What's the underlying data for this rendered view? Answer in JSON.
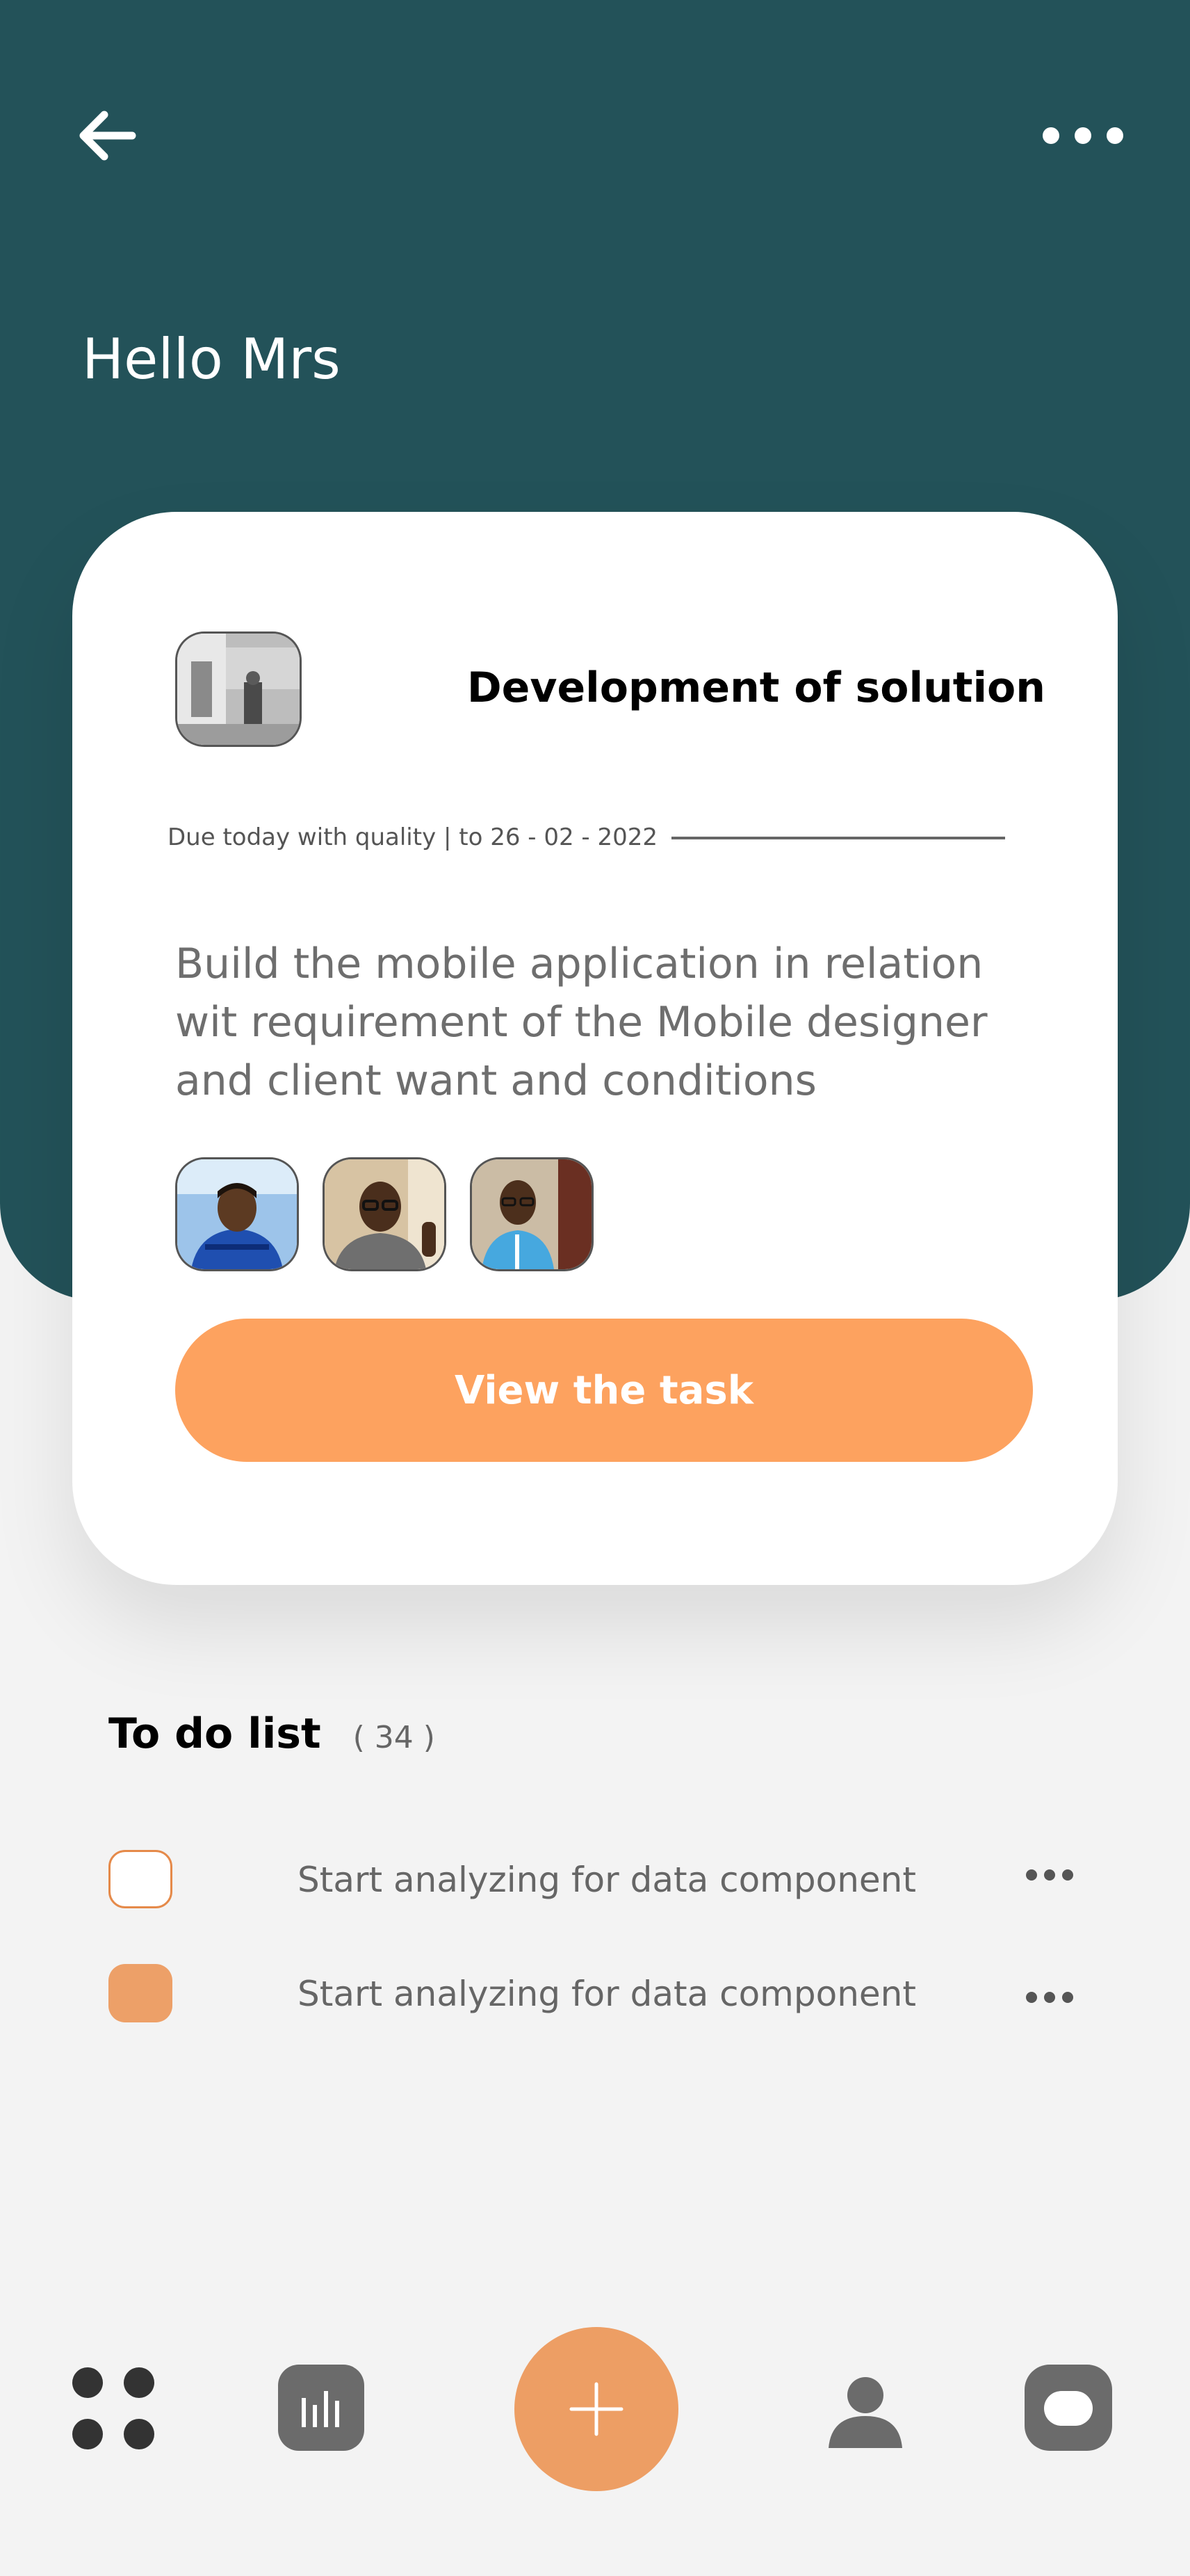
{
  "header": {
    "greeting": "Hello Mrs",
    "back_icon": "arrow-left-icon",
    "more_icon": "more-horizontal-icon",
    "background_color": "#235259"
  },
  "task_card": {
    "thumbnail_icon": "project-thumbnail",
    "title": "Development of solution",
    "due_text": "Due today with quality | to 26 - 02 - 2022",
    "description": "Build the mobile application in relation wit requirement of the Mobile designer and client want and conditions",
    "members": [
      {
        "avatar": "member-avatar-1"
      },
      {
        "avatar": "member-avatar-2"
      },
      {
        "avatar": "member-avatar-3"
      }
    ],
    "action_label": "View the task",
    "action_color": "#fda25f"
  },
  "todo": {
    "title": "To do list",
    "count": "( 34 )",
    "items": [
      {
        "text": "Start analyzing for data component",
        "checked": false
      },
      {
        "text": "Start analyzing for data component",
        "checked": true
      }
    ]
  },
  "bottom_nav": {
    "items": [
      {
        "icon": "dashboard-grid-icon"
      },
      {
        "icon": "stats-chart-icon"
      },
      {
        "icon": "plus-icon",
        "color": "#ed9e64"
      },
      {
        "icon": "person-icon"
      },
      {
        "icon": "chat-icon"
      }
    ]
  }
}
